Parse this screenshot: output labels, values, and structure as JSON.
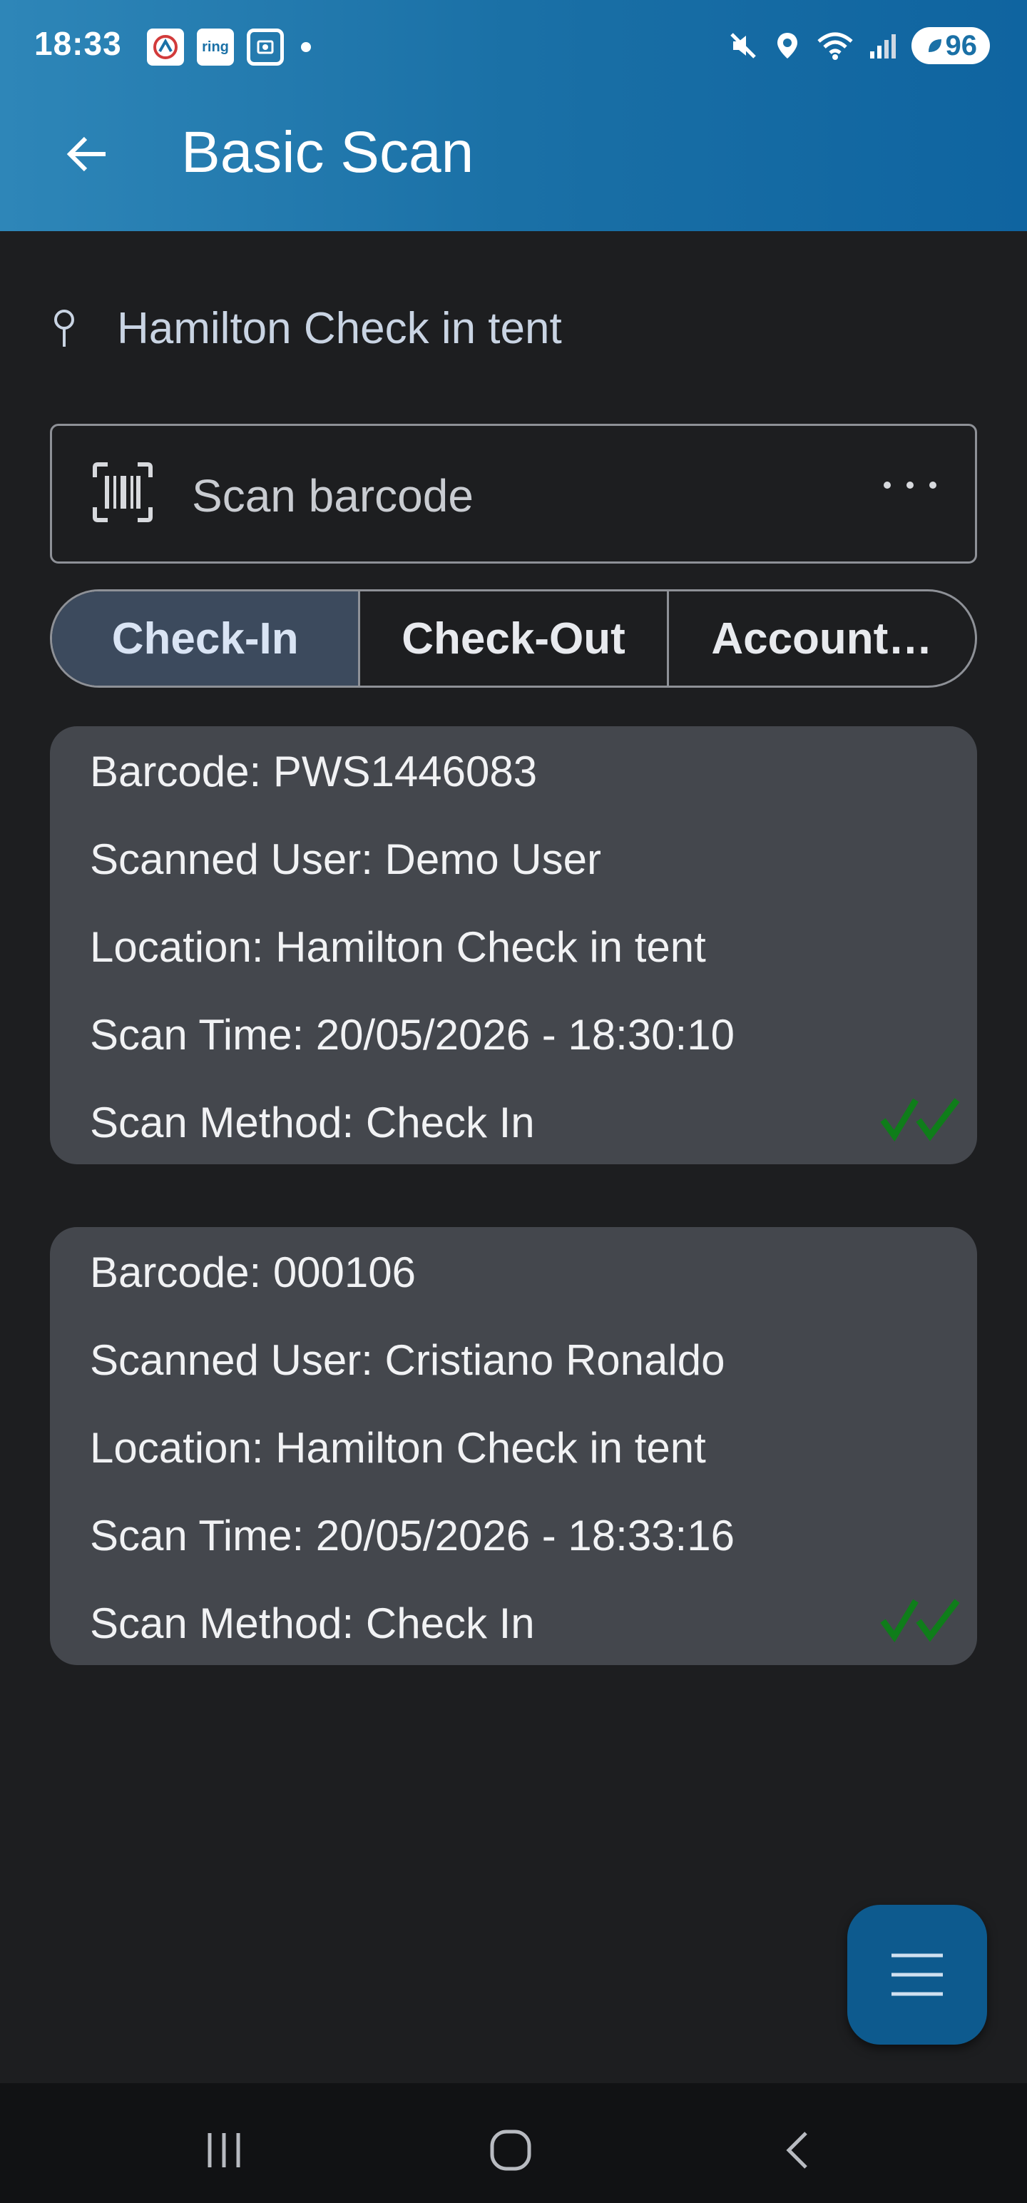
{
  "status_bar": {
    "time": "18:33",
    "notif_ring_label": "ring",
    "battery_level": "96"
  },
  "header": {
    "title": "Basic Scan"
  },
  "location": {
    "name": "Hamilton Check in tent"
  },
  "scan": {
    "placeholder": "Scan barcode"
  },
  "tabs": [
    {
      "label": "Check-In",
      "active": true
    },
    {
      "label": "Check-Out",
      "active": false
    },
    {
      "label": "Account…",
      "active": false
    }
  ],
  "scans": [
    {
      "barcode": "Barcode: PWS1446083",
      "user": "Scanned User: Demo User",
      "location": "Location: Hamilton Check in tent",
      "time": "Scan Time: 20/05/2026 - 18:30:10",
      "method": "Scan Method: Check In"
    },
    {
      "barcode": "Barcode: 000106",
      "user": "Scanned User: Cristiano Ronaldo",
      "location": "Location: Hamilton Check in tent",
      "time": "Scan Time: 20/05/2026 - 18:33:16",
      "method": "Scan Method: Check In"
    }
  ],
  "colors": {
    "accent": "#1a70a6",
    "background": "#1d1e20",
    "card": "#44474d",
    "status_success": "#0f7d1a",
    "fab": "#0d5a8e"
  },
  "icons": {
    "back": "arrow-left-icon",
    "location": "location-pin-icon",
    "scanner": "barcode-scanner-icon",
    "more": "more-horizontal-icon",
    "status": "double-check-icon",
    "fab": "menu-icon"
  }
}
